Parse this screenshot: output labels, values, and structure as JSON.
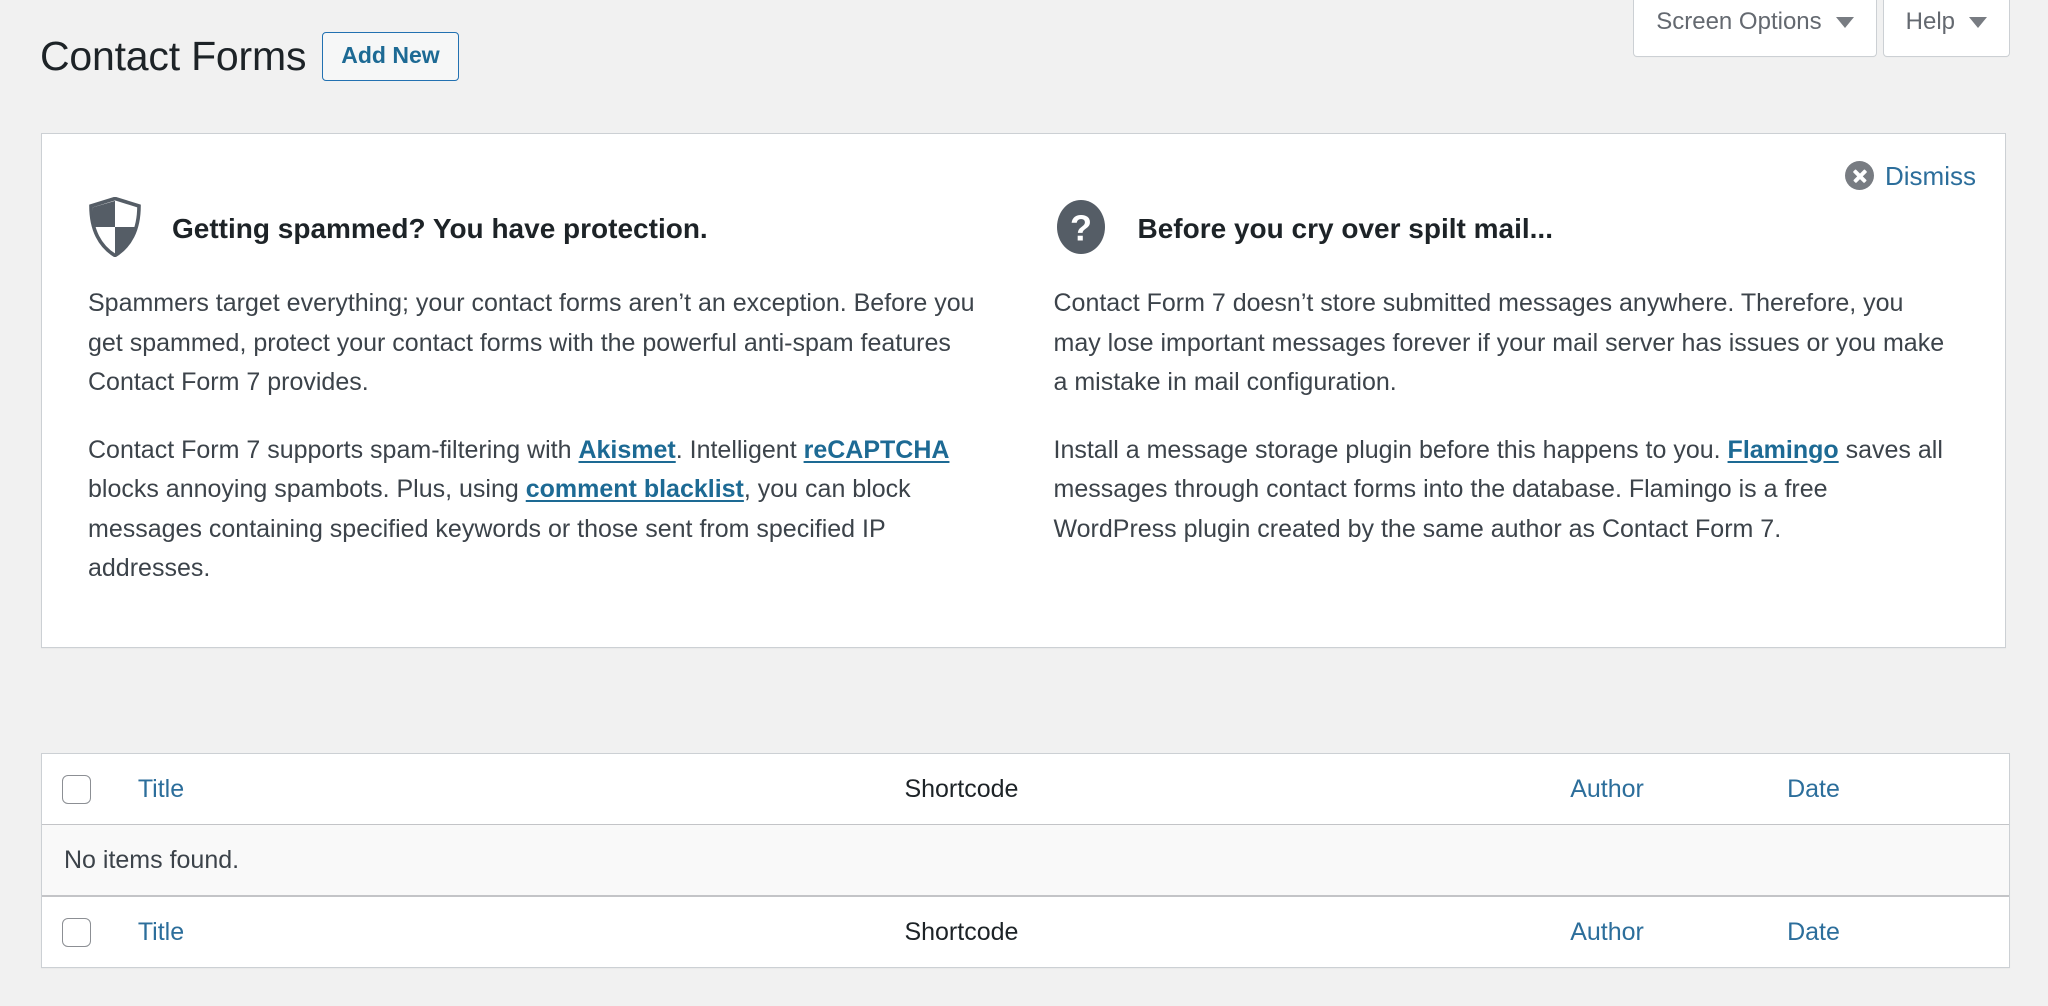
{
  "screen_meta": {
    "screen_options_label": "Screen Options",
    "help_label": "Help"
  },
  "header": {
    "page_title": "Contact Forms",
    "add_new_label": "Add New"
  },
  "welcome_panel": {
    "dismiss_label": "Dismiss",
    "columns": [
      {
        "icon": "shield-icon",
        "heading": "Getting spammed? You have protection.",
        "paragraph_1": "Spammers target everything; your contact forms aren’t an exception. Before you get spammed, protect your contact forms with the powerful anti-spam features Contact Form 7 provides.",
        "paragraph_2_part_1": "Contact Form 7 supports spam-filtering with ",
        "link_akismet": "Akismet",
        "paragraph_2_part_2": ". Intelligent ",
        "link_recaptcha": "reCAPTCHA",
        "paragraph_2_part_3": " blocks annoying spambots. Plus, using ",
        "link_comment_blacklist": "comment blacklist",
        "paragraph_2_part_4": ", you can block messages containing specified keywords or those sent from specified IP addresses."
      },
      {
        "icon": "question-mark-icon",
        "heading": "Before you cry over spilt mail...",
        "paragraph_1": "Contact Form 7 doesn’t store submitted messages anywhere. Therefore, you may lose important messages forever if your mail server has issues or you make a mistake in mail configuration.",
        "paragraph_2_part_1": "Install a message storage plugin before this happens to you. ",
        "link_flamingo": "Flamingo",
        "paragraph_2_part_2": " saves all messages through contact forms into the database. Flamingo is a free WordPress plugin created by the same author as Contact Form 7."
      }
    ]
  },
  "list_table": {
    "columns": {
      "title": "Title",
      "shortcode": "Shortcode",
      "author": "Author",
      "date": "Date"
    },
    "empty_message": "No items found."
  },
  "colors": {
    "link_blue": "#1d6a94",
    "sortable_blue": "#2c6e9b",
    "button_border": "#2271b1",
    "page_bg": "#f1f1f1",
    "panel_border": "#ccd0d4",
    "icon_gray": "#555d66",
    "text_dark": "#1d2327",
    "text_body": "#3c434a"
  }
}
